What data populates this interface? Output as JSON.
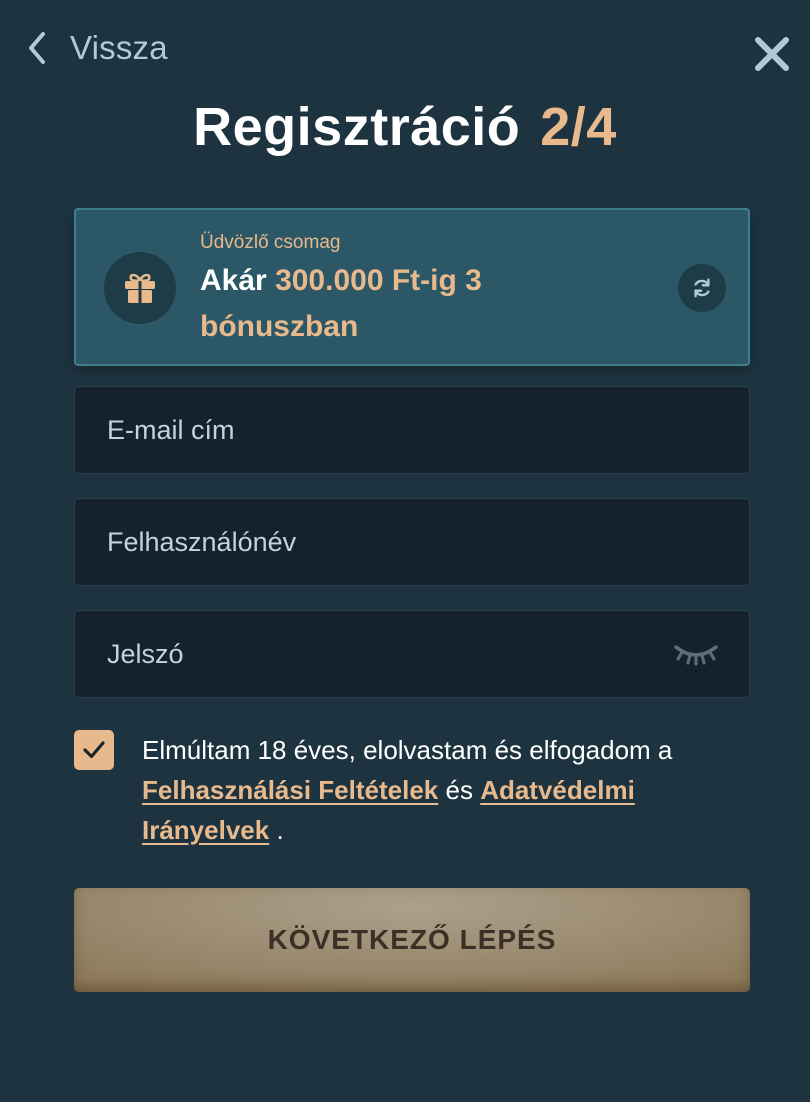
{
  "header": {
    "back_label": "Vissza",
    "title": "Regisztráció",
    "step": "2/4"
  },
  "bonus": {
    "subtitle": "Üdvözlő csomag",
    "prefix": "Akár",
    "highlight": "300.000 Ft-ig 3 bónuszban",
    "icon": "gift-icon",
    "action_icon": "refresh-icon"
  },
  "form": {
    "email_placeholder": "E-mail cím",
    "username_placeholder": "Felhasználónév",
    "password_placeholder": "Jelszó",
    "password_toggle_icon": "eye-closed-icon"
  },
  "terms": {
    "checked": true,
    "text_before": "Elmúltam 18 éves, elolvastam és elfogadom a",
    "link_terms": "Felhasználási Feltételek",
    "conjunction": "és",
    "link_privacy": "Adatvédelmi Irányelvek",
    "period": "."
  },
  "next_button": {
    "label": "KÖVETKEZŐ LÉPÉS"
  },
  "colors": {
    "background": "#1d3440",
    "accent": "#e8b98c",
    "card": "#2b5766",
    "input": "#16222b"
  }
}
